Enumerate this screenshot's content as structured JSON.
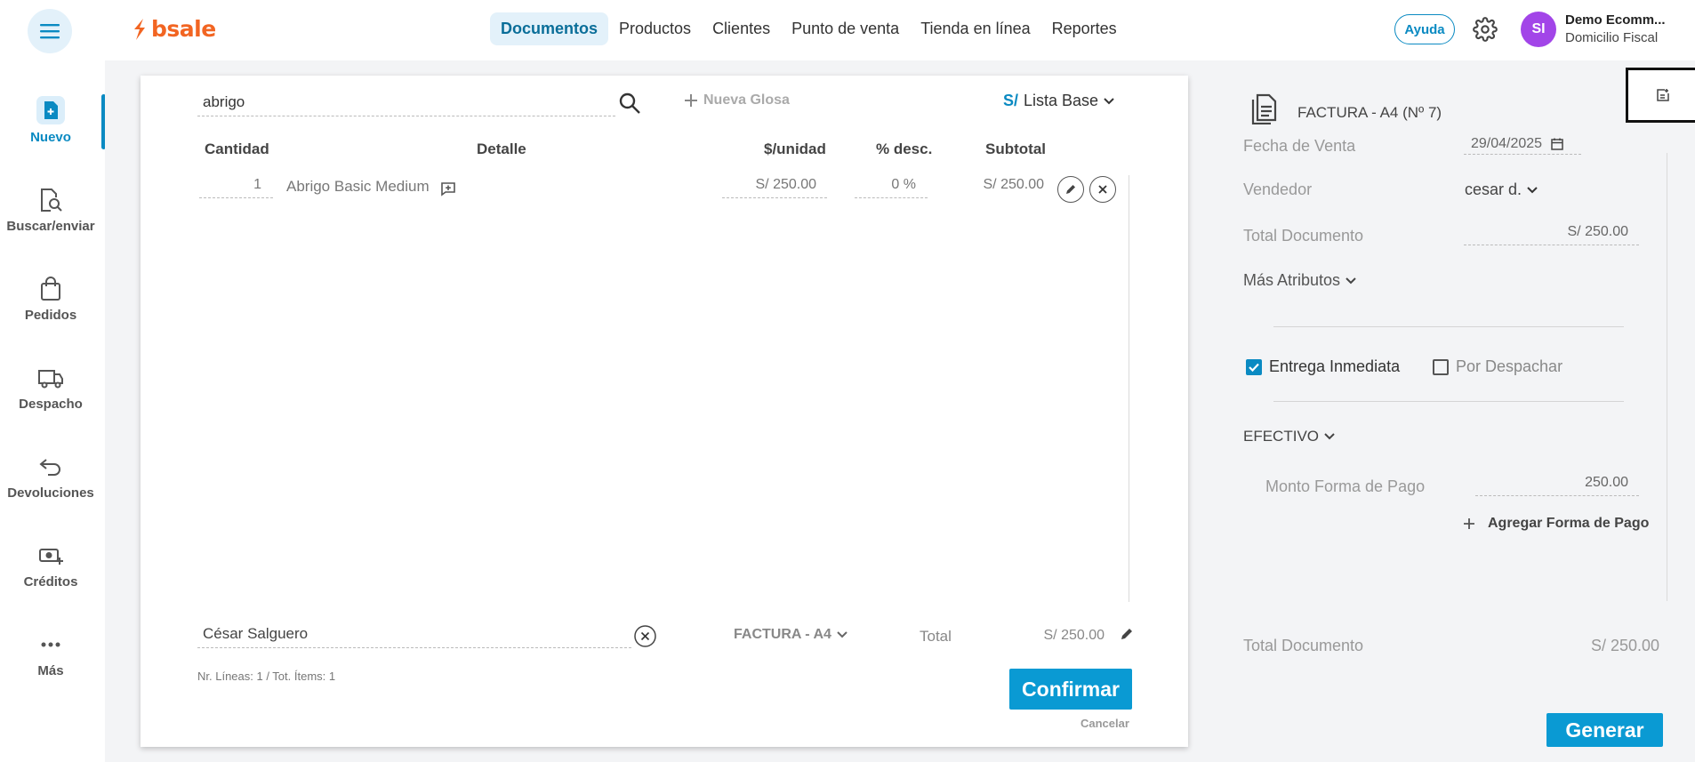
{
  "brand": {
    "name": "bsale",
    "color": "#f26522"
  },
  "header": {
    "nav": [
      "Documentos",
      "Productos",
      "Clientes",
      "Punto de venta",
      "Tienda en línea",
      "Reportes"
    ],
    "help_label": "Ayuda",
    "user_initials": "SI",
    "user_name": "Demo Ecomm...",
    "user_sub": "Domicilio Fiscal"
  },
  "sidebar": {
    "items": [
      {
        "label": "Nuevo",
        "icon": "new-document-icon"
      },
      {
        "label": "Buscar/enviar",
        "icon": "search-document-icon"
      },
      {
        "label": "Pedidos",
        "icon": "shopping-bag-icon"
      },
      {
        "label": "Despacho",
        "icon": "truck-icon"
      },
      {
        "label": "Devoluciones",
        "icon": "return-arrow-icon"
      },
      {
        "label": "Créditos",
        "icon": "money-plus-icon"
      },
      {
        "label": "Más",
        "icon": "more-dots-icon"
      }
    ]
  },
  "document": {
    "search_value": "abrigo",
    "nueva_glosa": "Nueva Glosa",
    "currency_symbol": "S/",
    "price_list": "Lista Base",
    "columns": {
      "cantidad": "Cantidad",
      "detalle": "Detalle",
      "unit": "$/unidad",
      "desc": "% desc.",
      "subtotal": "Subtotal"
    },
    "rows": [
      {
        "qty": "1",
        "detail": "Abrigo Basic Medium",
        "unit_price": "S/ 250.00",
        "discount": "0 %",
        "subtotal": "S/ 250.00"
      }
    ],
    "client": "César Salguero",
    "doc_type": "FACTURA - A4",
    "total_label": "Total",
    "total_value": "S/ 250.00",
    "counts": "Nr. Líneas: 1 / Tot. Ítems: 1",
    "confirm_label": "Confirmar",
    "cancel_label": "Cancelar"
  },
  "panel": {
    "title": "FACTURA - A4 (Nº 7)",
    "fecha_label": "Fecha de Venta",
    "fecha_value": "29/04/2025",
    "vendedor_label": "Vendedor",
    "vendedor_value": "cesar d.",
    "total_doc_label": "Total Documento",
    "total_doc_value": "S/ 250.00",
    "mas_atributos": "Más Atributos",
    "entrega_inmediata": "Entrega Inmediata",
    "por_despachar": "Por Despachar",
    "entrega_inmediata_checked": true,
    "por_despachar_checked": false,
    "payment_method": "EFECTIVO",
    "monto_label": "Monto Forma de Pago",
    "monto_value": "250.00",
    "agregar_forma": "Agregar Forma de Pago",
    "bottom_total_label": "Total Documento",
    "bottom_total_value": "S/ 250.00",
    "generate_label": "Generar"
  },
  "colors": {
    "accent": "#0a8ac2",
    "button": "#0a9ad3",
    "avatar": "#a245e8"
  }
}
